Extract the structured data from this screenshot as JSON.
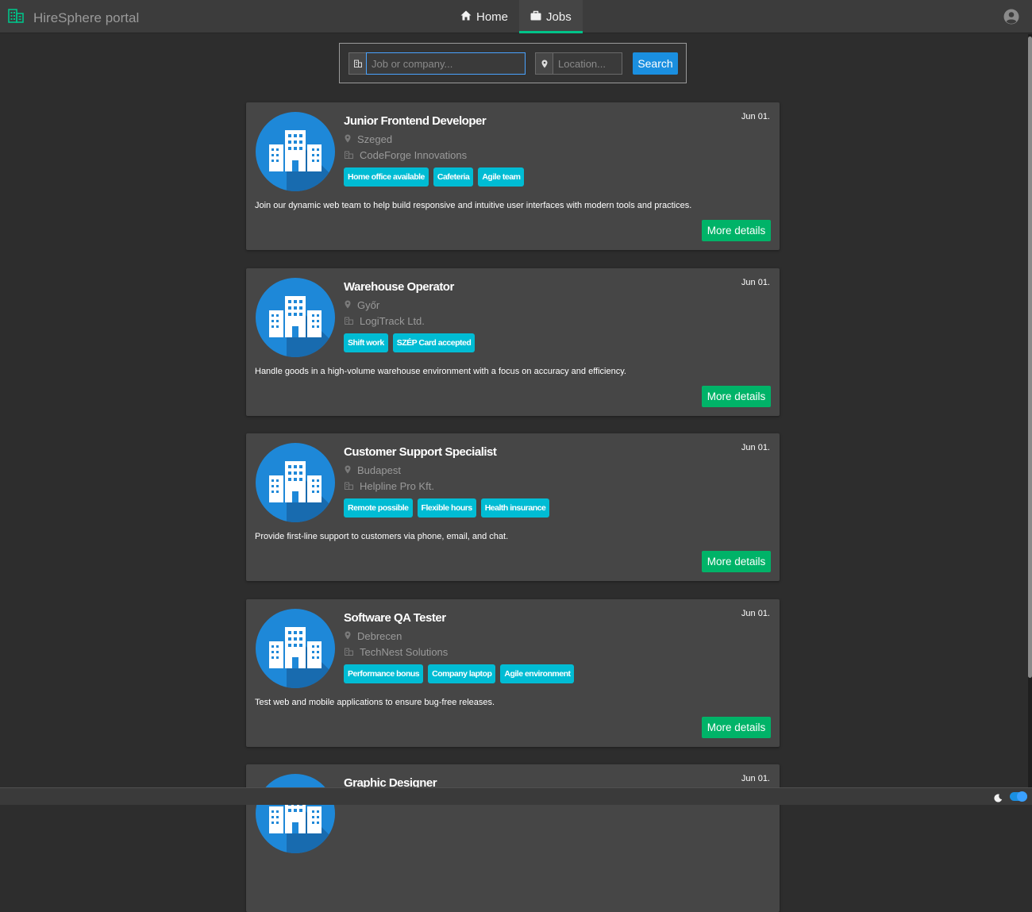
{
  "app": {
    "brand_title": "HireSphere portal",
    "accent_color": "#00c389"
  },
  "nav": {
    "home_label": "Home",
    "jobs_label": "Jobs",
    "active_tab": "Jobs"
  },
  "search": {
    "job_placeholder": "Job or company...",
    "location_placeholder": "Location...",
    "button_label": "Search"
  },
  "jobs": [
    {
      "title": "Junior Frontend Developer",
      "date": "Jun 01.",
      "location": "Szeged",
      "company": "CodeForge Innovations",
      "tags": [
        "Home office available",
        "Cafeteria",
        "Agile team"
      ],
      "description": "Join our dynamic web team to help build responsive and intuitive user interfaces with modern tools and practices.",
      "button_label": "More details"
    },
    {
      "title": "Warehouse Operator",
      "date": "Jun 01.",
      "location": "Győr",
      "company": "LogiTrack Ltd.",
      "tags": [
        "Shift work",
        "SZÉP Card accepted"
      ],
      "description": "Handle goods in a high-volume warehouse environment with a focus on accuracy and efficiency.",
      "button_label": "More details"
    },
    {
      "title": "Customer Support Specialist",
      "date": "Jun 01.",
      "location": "Budapest",
      "company": "Helpline Pro Kft.",
      "tags": [
        "Remote possible",
        "Flexible hours",
        "Health insurance"
      ],
      "description": "Provide first-line support to customers via phone, email, and chat.",
      "button_label": "More details"
    },
    {
      "title": "Software QA Tester",
      "date": "Jun 01.",
      "location": "Debrecen",
      "company": "TechNest Solutions",
      "tags": [
        "Performance bonus",
        "Company laptop",
        "Agile environment"
      ],
      "description": "Test web and mobile applications to ensure bug-free releases.",
      "button_label": "More details"
    },
    {
      "title": "Graphic Designer",
      "date": "Jun 01."
    }
  ],
  "footer": {
    "theme_icon": "moon-icon",
    "dark_mode": true
  }
}
